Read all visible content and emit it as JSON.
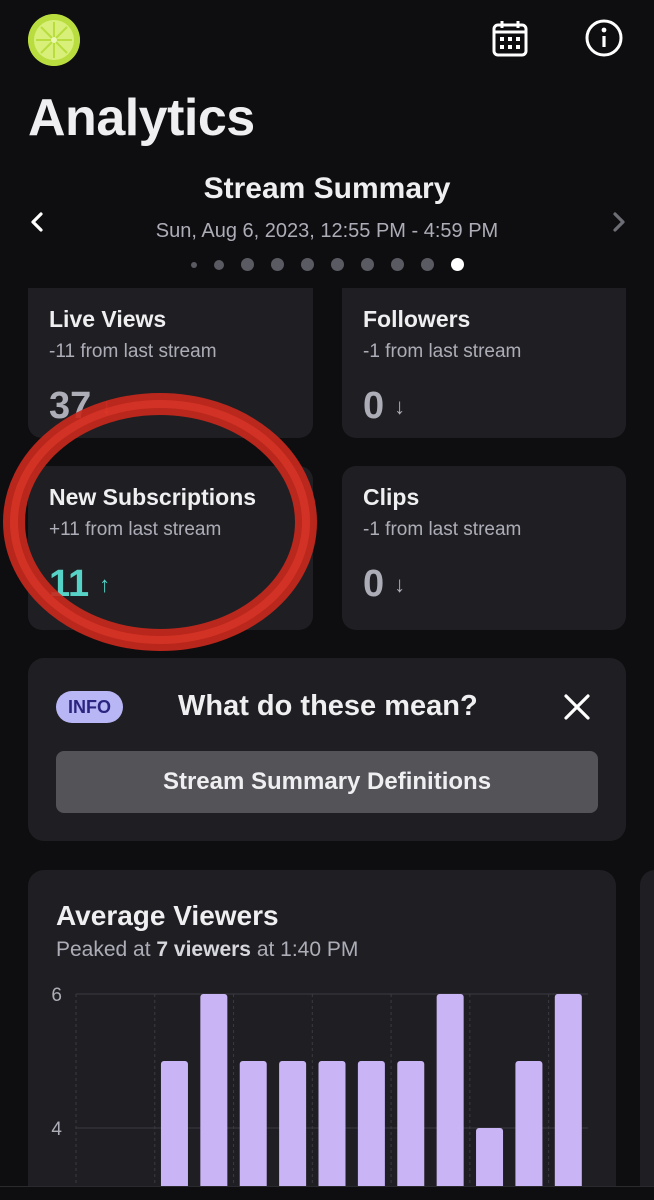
{
  "header": {
    "title": "Analytics",
    "avatar_icon": "lime-avatar",
    "calendar_icon": "calendar-icon",
    "info_icon": "info-circle-icon"
  },
  "summary": {
    "title": "Stream Summary",
    "date_range": "Sun, Aug 6, 2023, 12:55 PM - 4:59 PM",
    "page_count": 10,
    "active_page": 10
  },
  "stats": [
    {
      "label": "Live Views",
      "change": "-11 from last stream",
      "value": "37",
      "trend": "↓"
    },
    {
      "label": "Followers",
      "change": "-1 from last stream",
      "value": "0",
      "trend": "↓"
    },
    {
      "label": "New Subscriptions",
      "change": "+11 from last stream",
      "value": "11",
      "trend": "↑"
    },
    {
      "label": "Clips",
      "change": "-1 from last stream",
      "value": "0",
      "trend": "↓"
    }
  ],
  "info_card": {
    "badge": "INFO",
    "question": "What do these mean?",
    "button_label": "Stream Summary Definitions"
  },
  "chart_section": {
    "title": "Average Viewers",
    "subtitle_prefix": "Peaked at ",
    "subtitle_peak": "7 viewers",
    "subtitle_suffix": " at 1:40 PM"
  },
  "colors": {
    "background": "#0e0e10",
    "card": "#1f1f23",
    "accent_bar": "#c9b5f5",
    "up_teal": "#57d2c6",
    "down_red": "#e25b5b",
    "annotation_red": "#d42a1e"
  },
  "chart_data": {
    "type": "bar",
    "ylabel": "",
    "xlabel": "",
    "yticks": [
      6,
      4
    ],
    "values": [
      0,
      0,
      5,
      6,
      5,
      5,
      5,
      5,
      5,
      6,
      4,
      5,
      6
    ],
    "ylim_visible": [
      3.2,
      6.0
    ],
    "grid": true
  }
}
